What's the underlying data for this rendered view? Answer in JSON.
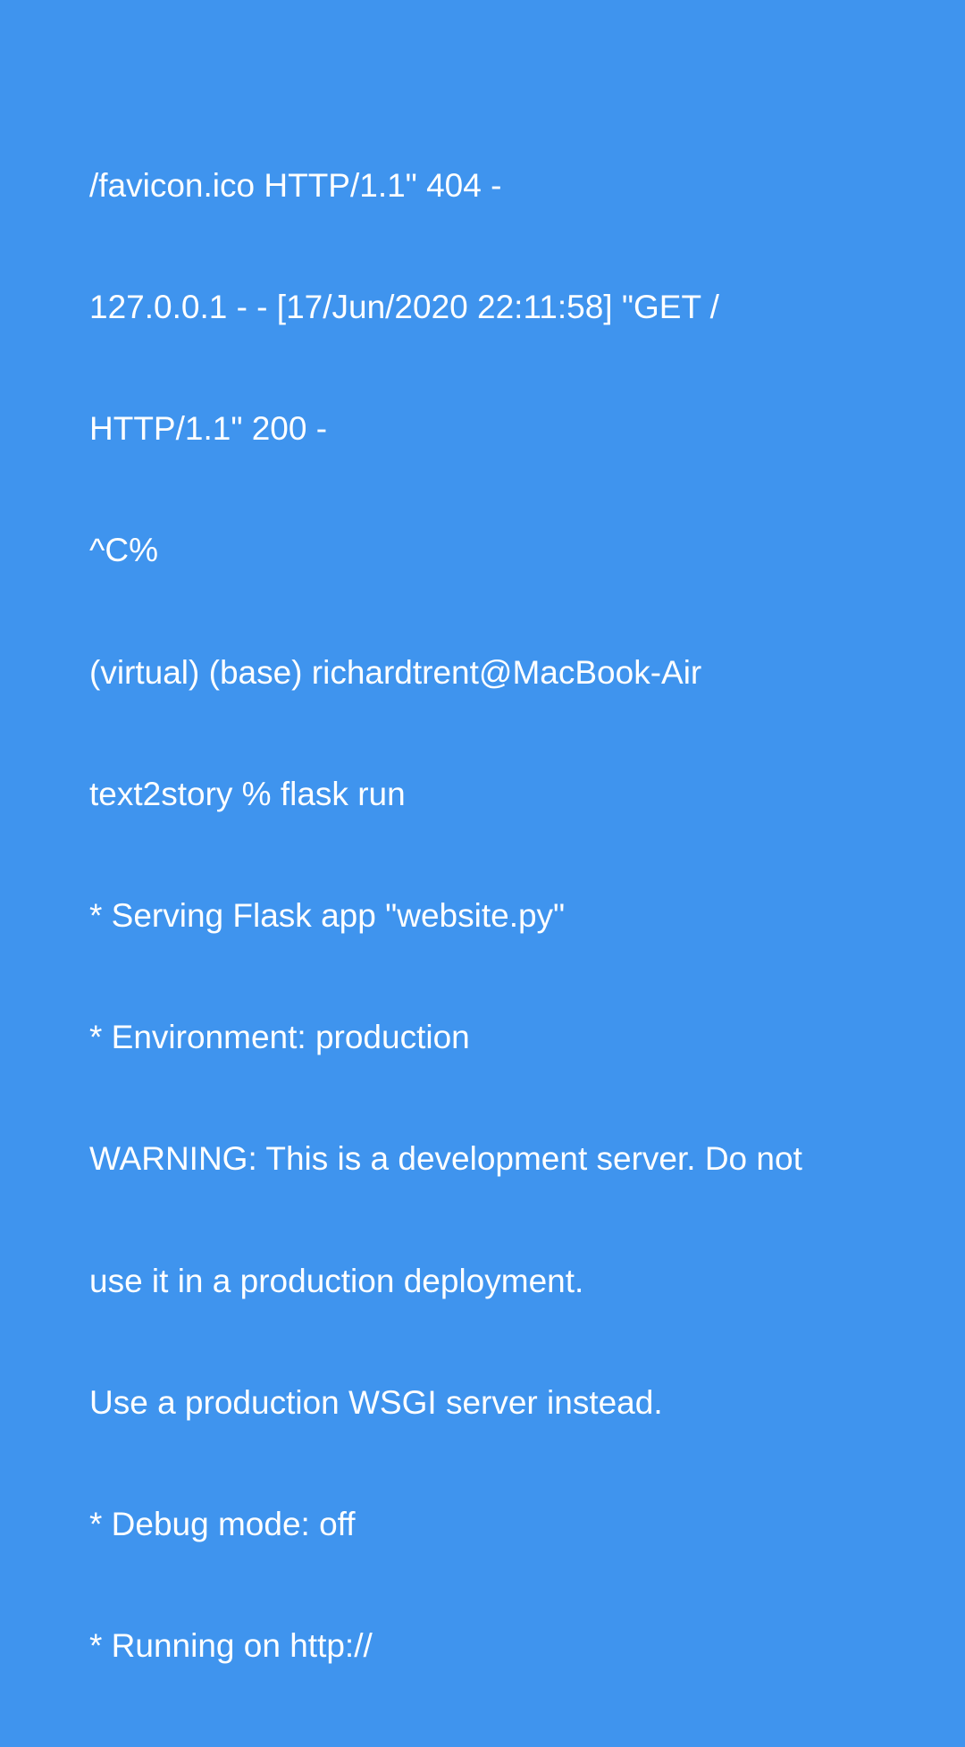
{
  "colors": {
    "background": "#3f94ee",
    "text": "#ffffff"
  },
  "terminal": {
    "lines": [
      "/favicon.ico HTTP/1.1\" 404 -",
      "127.0.0.1 - - [17/Jun/2020 22:11:58] \"GET /",
      "HTTP/1.1\" 200 -",
      "^C%",
      "(virtual) (base) richardtrent@MacBook-Air",
      "text2story % flask run",
      "* Serving Flask app \"website.py\"",
      "* Environment: production",
      "WARNING: This is a development server. Do not",
      "use it in a production deployment.",
      "Use a production WSGI server instead.",
      "* Debug mode: off",
      "* Running on http://"
    ]
  }
}
